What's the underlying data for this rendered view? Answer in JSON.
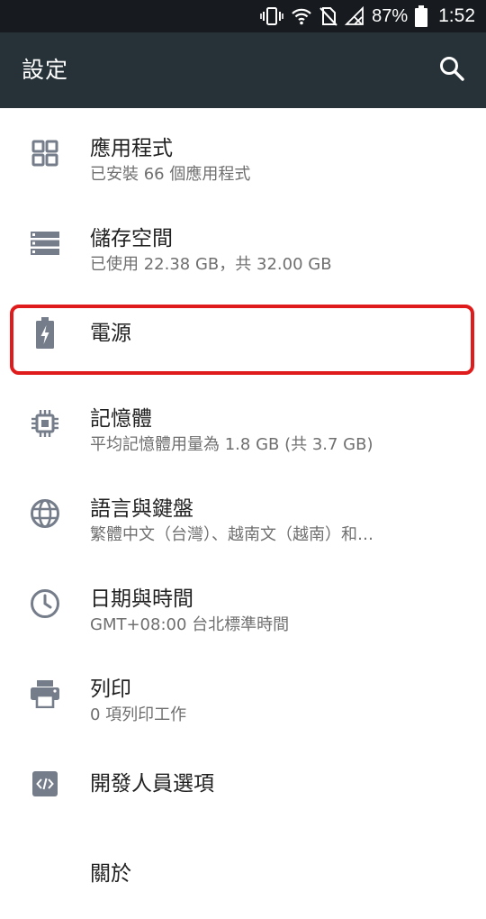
{
  "status_bar": {
    "battery_percent": "87%",
    "time": "1:52"
  },
  "toolbar": {
    "title": "設定",
    "search_icon": "search-icon"
  },
  "settings": [
    {
      "title": "應用程式",
      "subtitle": "已安裝 66 個應用程式",
      "icon": "apps-icon"
    },
    {
      "title": "儲存空間",
      "subtitle": "已使用 22.38 GB，共 32.00 GB",
      "icon": "storage-icon"
    },
    {
      "title": "電源",
      "subtitle": "",
      "icon": "battery-icon"
    },
    {
      "title": "記憶體",
      "subtitle": "平均記憶體用量為 1.8 GB (共 3.7 GB)",
      "icon": "memory-icon"
    },
    {
      "title": "語言與鍵盤",
      "subtitle": "繁體中文（台灣）、越南文（越南）和…",
      "icon": "language-icon"
    },
    {
      "title": "日期與時間",
      "subtitle": "GMT+08:00 台北標準時間",
      "icon": "clock-icon"
    },
    {
      "title": "列印",
      "subtitle": "0 項列印工作",
      "icon": "print-icon"
    },
    {
      "title": "開發人員選項",
      "subtitle": "",
      "icon": "developer-icon"
    },
    {
      "title": "關於",
      "subtitle": "",
      "icon": "about-icon"
    }
  ],
  "colors": {
    "status_bar": "#171b1f",
    "toolbar": "#263238",
    "icon_gray": "#757d8a",
    "highlight_red": "#e01b1b"
  }
}
